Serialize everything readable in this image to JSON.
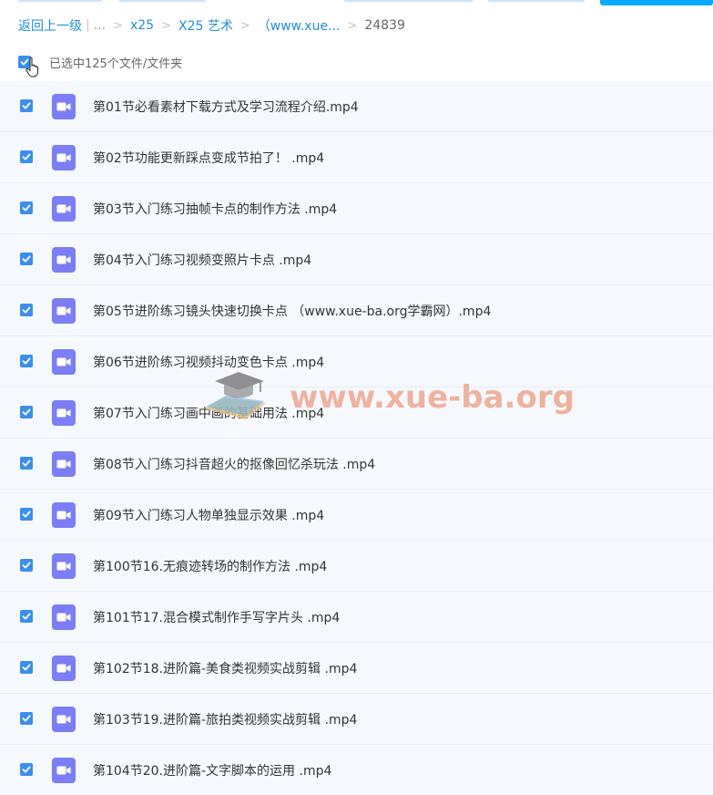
{
  "breadcrumb": {
    "back": "返回上一级",
    "bar": "|",
    "ellipsis": "...",
    "items": [
      "x25",
      "X25 艺术",
      "（www.xue...",
      "24839"
    ],
    "separator": ">"
  },
  "selection": {
    "label": "已选中125个文件/文件夹"
  },
  "files": [
    {
      "name": "第01节必看素材下载方式及学习流程介绍.mp4"
    },
    {
      "name": "第02节功能更新踩点变成节拍了！ .mp4"
    },
    {
      "name": "第03节入门练习抽帧卡点的制作方法 .mp4"
    },
    {
      "name": "第04节入门练习视频变照片卡点 .mp4"
    },
    {
      "name": "第05节进阶练习镜头快速切换卡点 （www.xue-ba.org学霸网）.mp4"
    },
    {
      "name": "第06节进阶练习视频抖动变色卡点 .mp4"
    },
    {
      "name": "第07节入门练习画中画的基础用法 .mp4"
    },
    {
      "name": "第08节入门练习抖音超火的抠像回忆杀玩法 .mp4"
    },
    {
      "name": "第09节入门练习人物单独显示效果 .mp4"
    },
    {
      "name": "第100节16.无痕迹转场的制作方法 .mp4"
    },
    {
      "name": "第101节17.混合模式制作手写字片头 .mp4"
    },
    {
      "name": "第102节18.进阶篇-美食类视频实战剪辑 .mp4"
    },
    {
      "name": "第103节19.进阶篇-旅拍类视频实战剪辑 .mp4"
    },
    {
      "name": "第104节20.进阶篇-文字脚本的运用 .mp4"
    }
  ],
  "watermark": {
    "text": "www.xue-ba.org"
  },
  "colors": {
    "link": "#1e8ed6",
    "checkbox": "#3b8eea",
    "video_icon": "#7b7ef5",
    "row_bg": "#f5f9fe",
    "primary": "#09aaff"
  },
  "icons": {
    "file": "video-file-icon",
    "check": "checkmark-icon",
    "cursor": "hand-pointer-icon",
    "watermark": "graduation-cap-icon"
  }
}
